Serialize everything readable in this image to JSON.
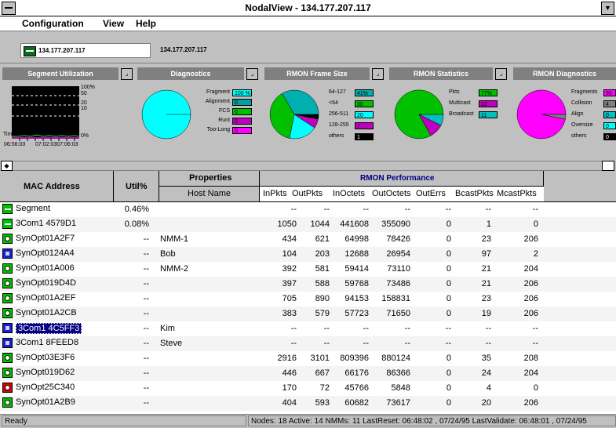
{
  "window": {
    "title": "NodalView - 134.177.207.117"
  },
  "menu": [
    "Configuration",
    "View",
    "Help"
  ],
  "toolbar": {
    "node_label": "134.177.207.117",
    "node_text": "134.177.207.117"
  },
  "panels": {
    "segment_utilization": {
      "title": "Segment Utilization",
      "y_ticks": [
        "100%",
        "50",
        "20",
        "10",
        "0%"
      ],
      "time_label": "Time",
      "time_start": "06:56:03",
      "time_end": "07:02:0307:06:03"
    },
    "diagnostics": {
      "title": "Diagnostics",
      "legend": [
        {
          "label": "Fragment",
          "value": "100 %",
          "color": "#00ffff"
        },
        {
          "label": "Alignment",
          "value": "0",
          "color": "#00a0a0"
        },
        {
          "label": "FCS",
          "value": "0",
          "color": "#00c000"
        },
        {
          "label": "Runt",
          "value": "0",
          "color": "#c000c0"
        },
        {
          "label": "Too-Long",
          "value": "0",
          "color": "#ff00ff"
        }
      ]
    },
    "rmon_frame_size": {
      "title": "RMON Frame Size",
      "legend": [
        {
          "label": "64-127",
          "value": "41%",
          "color": "#00b0b0"
        },
        {
          "label": "<64",
          "value": "30",
          "color": "#00c000"
        },
        {
          "label": "256-511",
          "value": "20",
          "color": "#00ffff"
        },
        {
          "label": "128-255",
          "value": "7",
          "color": "#c000c0"
        },
        {
          "label": "others",
          "value": "1",
          "color": "#000000"
        }
      ]
    },
    "rmon_statistics": {
      "title": "RMON Statistics",
      "legend": [
        {
          "label": "Pkts",
          "value": "77%",
          "color": "#00c000"
        },
        {
          "label": "Multicast",
          "value": "12",
          "color": "#c000c0"
        },
        {
          "label": "Broadcast",
          "value": "11",
          "color": "#00c0c0"
        }
      ]
    },
    "rmon_diagnostics": {
      "title": "RMON Diagnostics",
      "legend": [
        {
          "label": "Fragments",
          "value": "96",
          "color": "#ff00ff"
        },
        {
          "label": "Collision",
          "value": "4",
          "color": "#808080"
        },
        {
          "label": "Align",
          "value": "0",
          "color": "#00c0c0"
        },
        {
          "label": "Oversize",
          "value": "0",
          "color": "#00ffff"
        },
        {
          "label": "others",
          "value": "0",
          "color": "#000000"
        }
      ]
    }
  },
  "table": {
    "headers": {
      "mac": "MAC Address",
      "util": "Util%",
      "properties": "Properties",
      "host": "Host Name",
      "rmon": "RMON Performance",
      "inpkts": "InPkts",
      "outpkts": "OutPkts",
      "inoctets": "InOctets",
      "outoctets": "OutOctets",
      "outerrs": "OutErrs",
      "bcast": "BcastPkts",
      "mcast": "McastPkts"
    },
    "rows": [
      {
        "icon": "seg",
        "mac": "Segment",
        "util": "0.46%",
        "host": "",
        "inpkts": "--",
        "outpkts": "--",
        "inoctets": "--",
        "outoctets": "--",
        "outerrs": "--",
        "bcast": "--",
        "mcast": "--"
      },
      {
        "icon": "seg",
        "mac": "3Com1 4579D1",
        "util": "0.08%",
        "host": "",
        "inpkts": "1050",
        "outpkts": "1044",
        "inoctets": "441608",
        "outoctets": "355090",
        "outerrs": "0",
        "bcast": "1",
        "mcast": "0"
      },
      {
        "icon": "lens",
        "mac": "SynOpt01A2F7",
        "util": "--",
        "host": "NMM-1",
        "inpkts": "434",
        "outpkts": "621",
        "inoctets": "64998",
        "outoctets": "78426",
        "outerrs": "0",
        "bcast": "23",
        "mcast": "206"
      },
      {
        "icon": "blue",
        "mac": "SynOpt0124A4",
        "util": "--",
        "host": "Bob",
        "inpkts": "104",
        "outpkts": "203",
        "inoctets": "12688",
        "outoctets": "26954",
        "outerrs": "0",
        "bcast": "97",
        "mcast": "2"
      },
      {
        "icon": "lens",
        "mac": "SynOpt01A006",
        "util": "--",
        "host": "NMM-2",
        "inpkts": "392",
        "outpkts": "581",
        "inoctets": "59414",
        "outoctets": "73110",
        "outerrs": "0",
        "bcast": "21",
        "mcast": "204"
      },
      {
        "icon": "lens",
        "mac": "SynOpt019D4D",
        "util": "--",
        "host": "",
        "inpkts": "397",
        "outpkts": "588",
        "inoctets": "59768",
        "outoctets": "73486",
        "outerrs": "0",
        "bcast": "21",
        "mcast": "206"
      },
      {
        "icon": "lens",
        "mac": "SynOpt01A2EF",
        "util": "--",
        "host": "",
        "inpkts": "705",
        "outpkts": "890",
        "inoctets": "94153",
        "outoctets": "158831",
        "outerrs": "0",
        "bcast": "23",
        "mcast": "206"
      },
      {
        "icon": "lens",
        "mac": "SynOpt01A2CB",
        "util": "--",
        "host": "",
        "inpkts": "383",
        "outpkts": "579",
        "inoctets": "57723",
        "outoctets": "71650",
        "outerrs": "0",
        "bcast": "19",
        "mcast": "206"
      },
      {
        "icon": "tile",
        "mac": "3Com1 4C5FF3",
        "util": "--",
        "host": "Kim",
        "inpkts": "--",
        "outpkts": "--",
        "inoctets": "--",
        "outoctets": "--",
        "outerrs": "--",
        "bcast": "--",
        "mcast": "--",
        "selected": true
      },
      {
        "icon": "tile",
        "mac": "3Com1 8FEED8",
        "util": "--",
        "host": "Steve",
        "inpkts": "--",
        "outpkts": "--",
        "inoctets": "--",
        "outoctets": "--",
        "outerrs": "--",
        "bcast": "--",
        "mcast": "--"
      },
      {
        "icon": "lens",
        "mac": "SynOpt03E3F6",
        "util": "--",
        "host": "",
        "inpkts": "2916",
        "outpkts": "3101",
        "inoctets": "809396",
        "outoctets": "880124",
        "outerrs": "0",
        "bcast": "35",
        "mcast": "208"
      },
      {
        "icon": "lens",
        "mac": "SynOpt019D62",
        "util": "--",
        "host": "",
        "inpkts": "446",
        "outpkts": "667",
        "inoctets": "66176",
        "outoctets": "86366",
        "outerrs": "0",
        "bcast": "24",
        "mcast": "204"
      },
      {
        "icon": "red",
        "mac": "SynOpt25C340",
        "util": "--",
        "host": "",
        "inpkts": "170",
        "outpkts": "72",
        "inoctets": "45766",
        "outoctets": "5848",
        "outerrs": "0",
        "bcast": "4",
        "mcast": "0"
      },
      {
        "icon": "lens",
        "mac": "SynOpt01A2B9",
        "util": "--",
        "host": "",
        "inpkts": "404",
        "outpkts": "593",
        "inoctets": "60682",
        "outoctets": "73617",
        "outerrs": "0",
        "bcast": "20",
        "mcast": "206"
      }
    ]
  },
  "status": {
    "ready": "Ready",
    "info": "Nodes: 18  Active: 14  NMMs: 11  LastReset:  06:48:02 , 07/24/95  LastValidate:  06:48:01 , 07/24/95"
  }
}
